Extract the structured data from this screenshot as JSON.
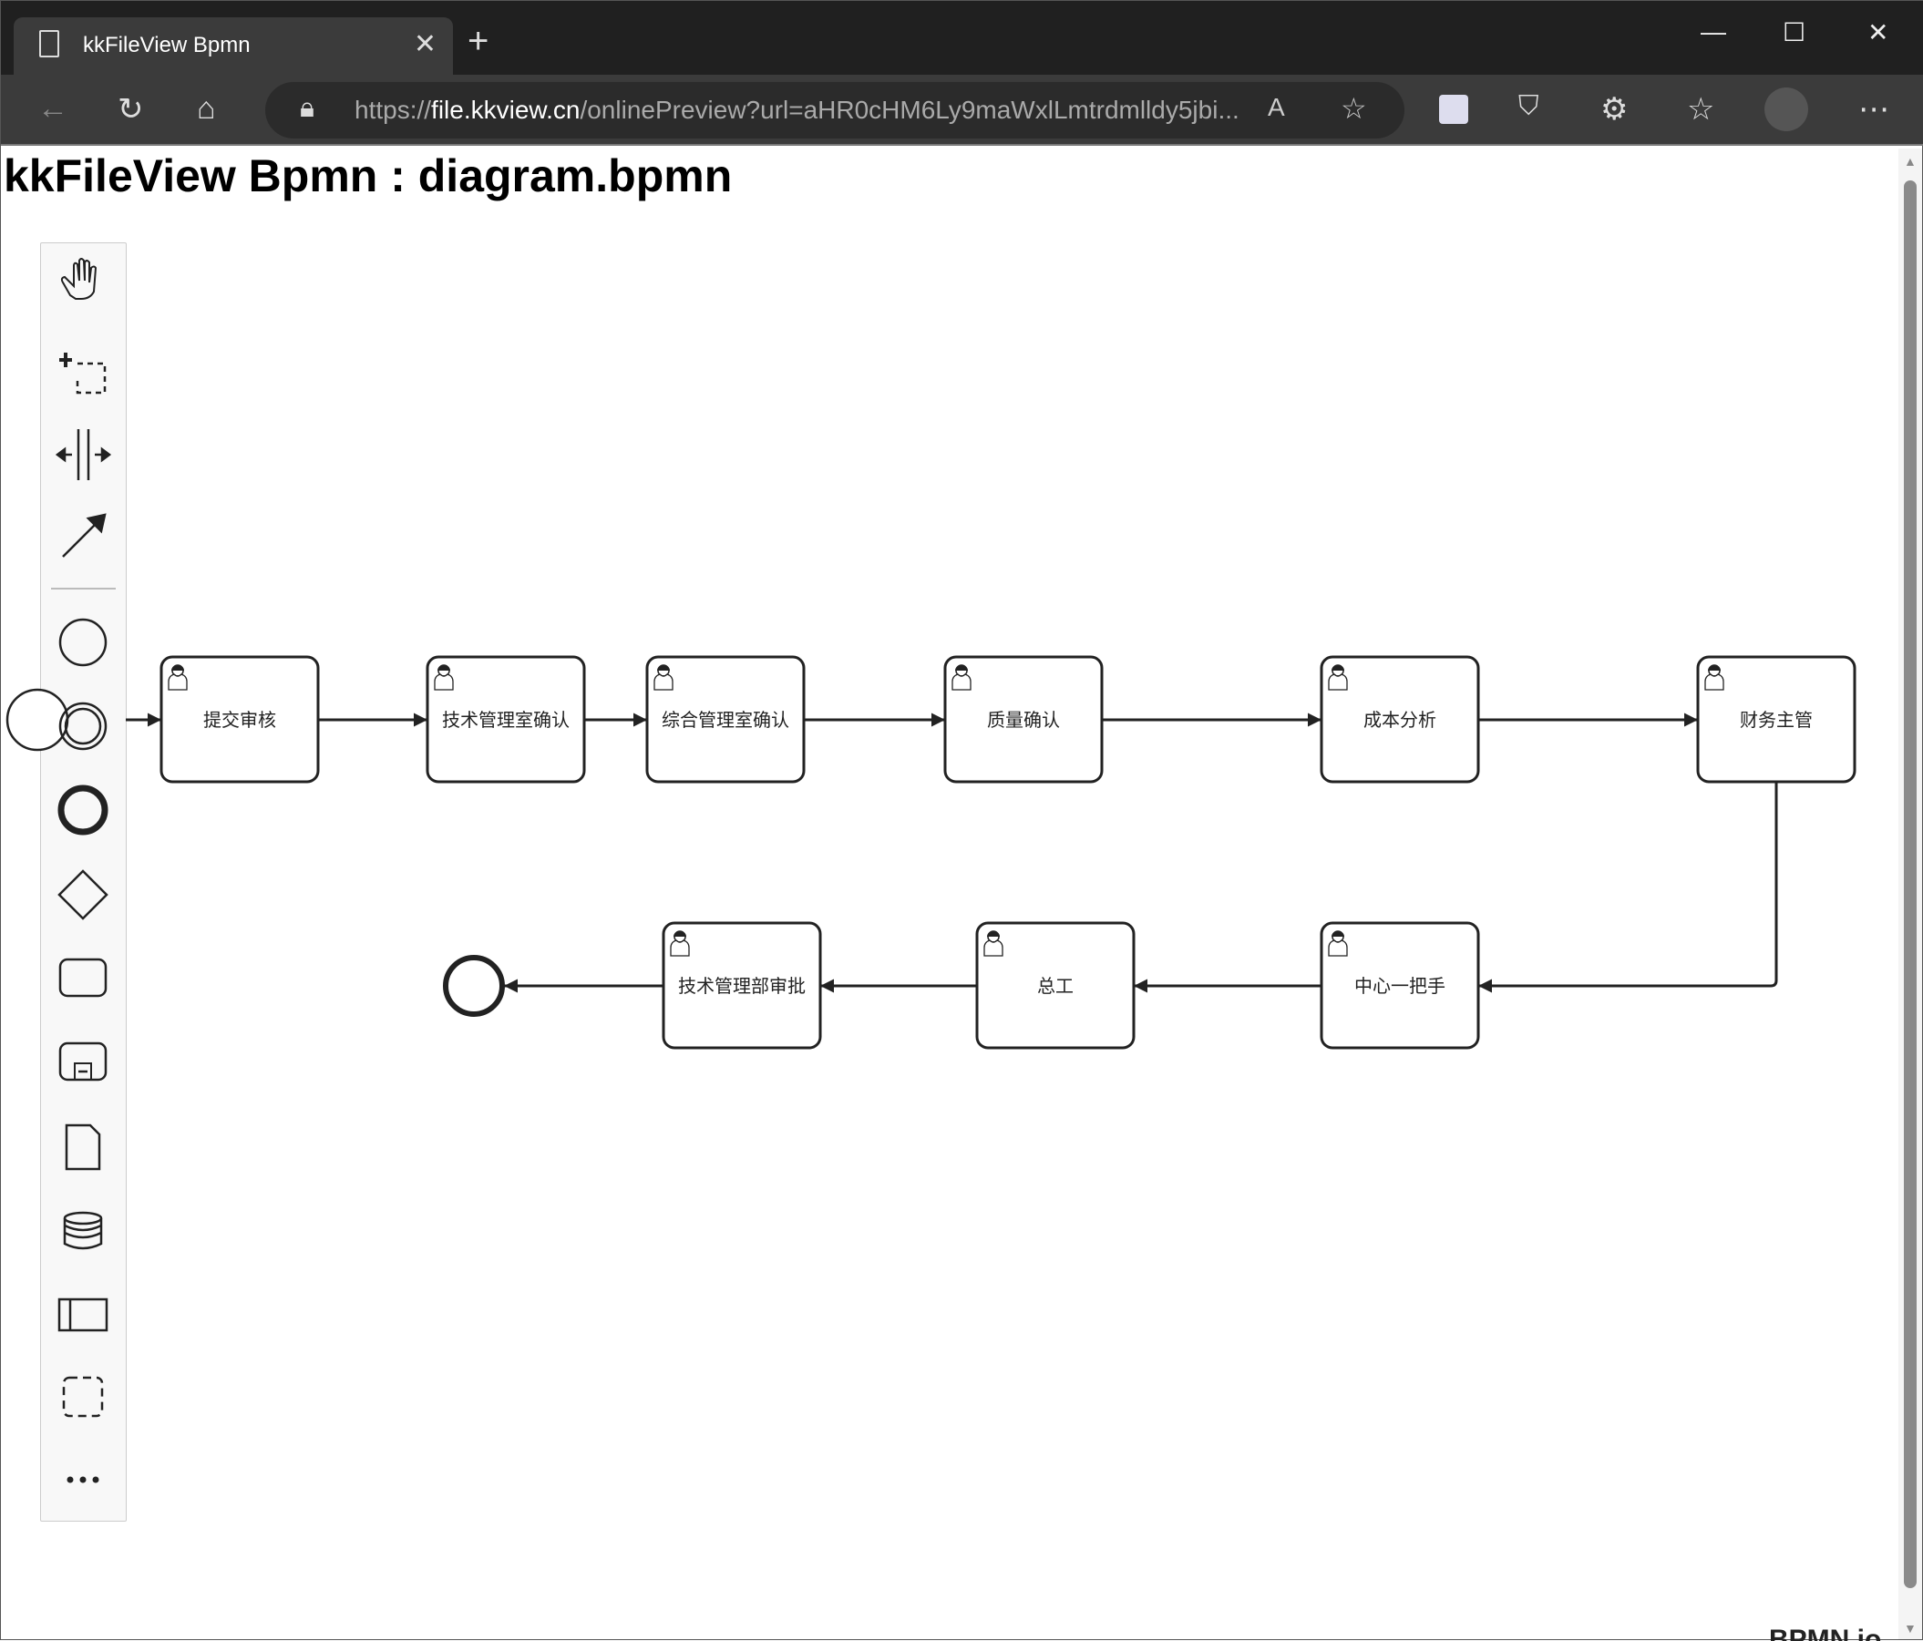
{
  "browser": {
    "tab_title": "kkFileView Bpmn",
    "url_prefix": "https://",
    "url_host": "file.kkview.cn",
    "url_rest": "/onlinePreview?url=aHR0cHM6Ly9maWxlLmtrdmlldy5jbi..."
  },
  "page": {
    "title": "kkFileView Bpmn : diagram.bpmn",
    "watermark": "BPMN.io"
  },
  "palette": [
    "hand-tool",
    "lasso-tool",
    "space-tool",
    "global-connect-tool",
    "create-start-event",
    "create-intermediate-event",
    "create-end-event",
    "create-gateway",
    "create-task",
    "create-subprocess",
    "create-data-object",
    "create-data-store",
    "create-pool",
    "create-group",
    "more"
  ],
  "tasks": {
    "t1": "提交审核",
    "t2": "技术管理室确认",
    "t3": "综合管理室确认",
    "t4": "质量确认",
    "t5": "成本分析",
    "t6": "财务主管",
    "t7": "中心一把手",
    "t8": "总工",
    "t9": "技术管理部审批"
  }
}
